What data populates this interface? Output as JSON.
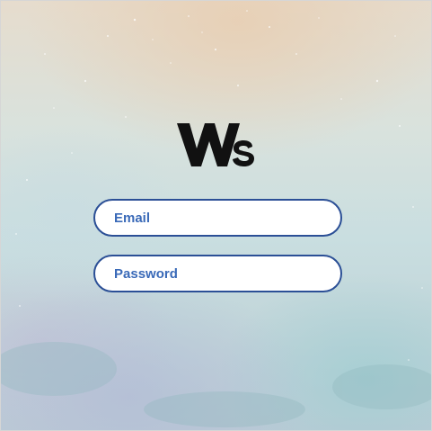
{
  "logo": {
    "text": "Ws",
    "icon": "ws-logo"
  },
  "form": {
    "email": {
      "placeholder": "Email",
      "value": ""
    },
    "password": {
      "placeholder": "Password",
      "value": ""
    }
  },
  "colors": {
    "field_border": "#2b4f96",
    "field_text": "#3a6ab8",
    "logo": "#111111"
  }
}
